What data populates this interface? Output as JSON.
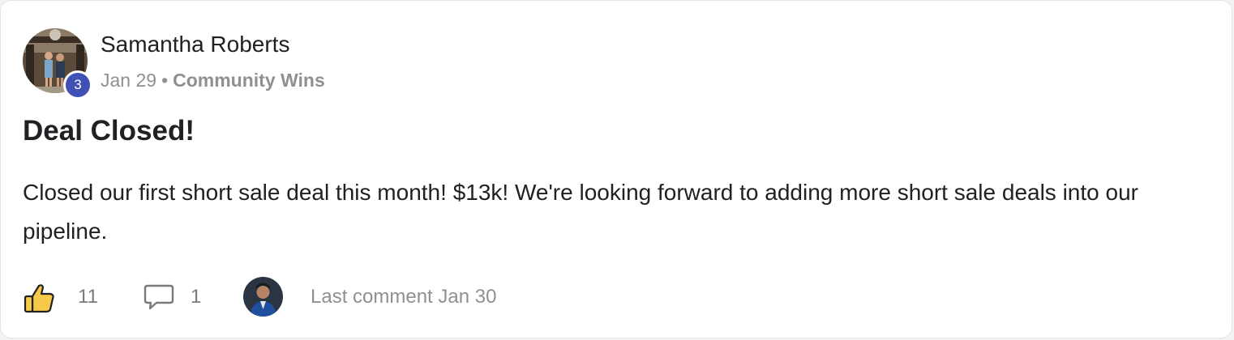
{
  "post": {
    "author": "Samantha Roberts",
    "level": "3",
    "date": "Jan 29",
    "separator": "•",
    "category": "Community Wins",
    "title": "Deal Closed!",
    "body": "Closed our first short sale deal this month! $13k! We're looking forward to adding more short sale deals into our pipeline.",
    "likes": "11",
    "comments": "1",
    "last_comment": "Last comment Jan 30"
  },
  "colors": {
    "level_badge": "#3f51b5",
    "like_icon_fill": "#f7c948",
    "text_primary": "#202124",
    "text_muted": "#909090"
  },
  "icons": {
    "like": "thumbs-up-icon",
    "comment": "speech-bubble-icon"
  }
}
